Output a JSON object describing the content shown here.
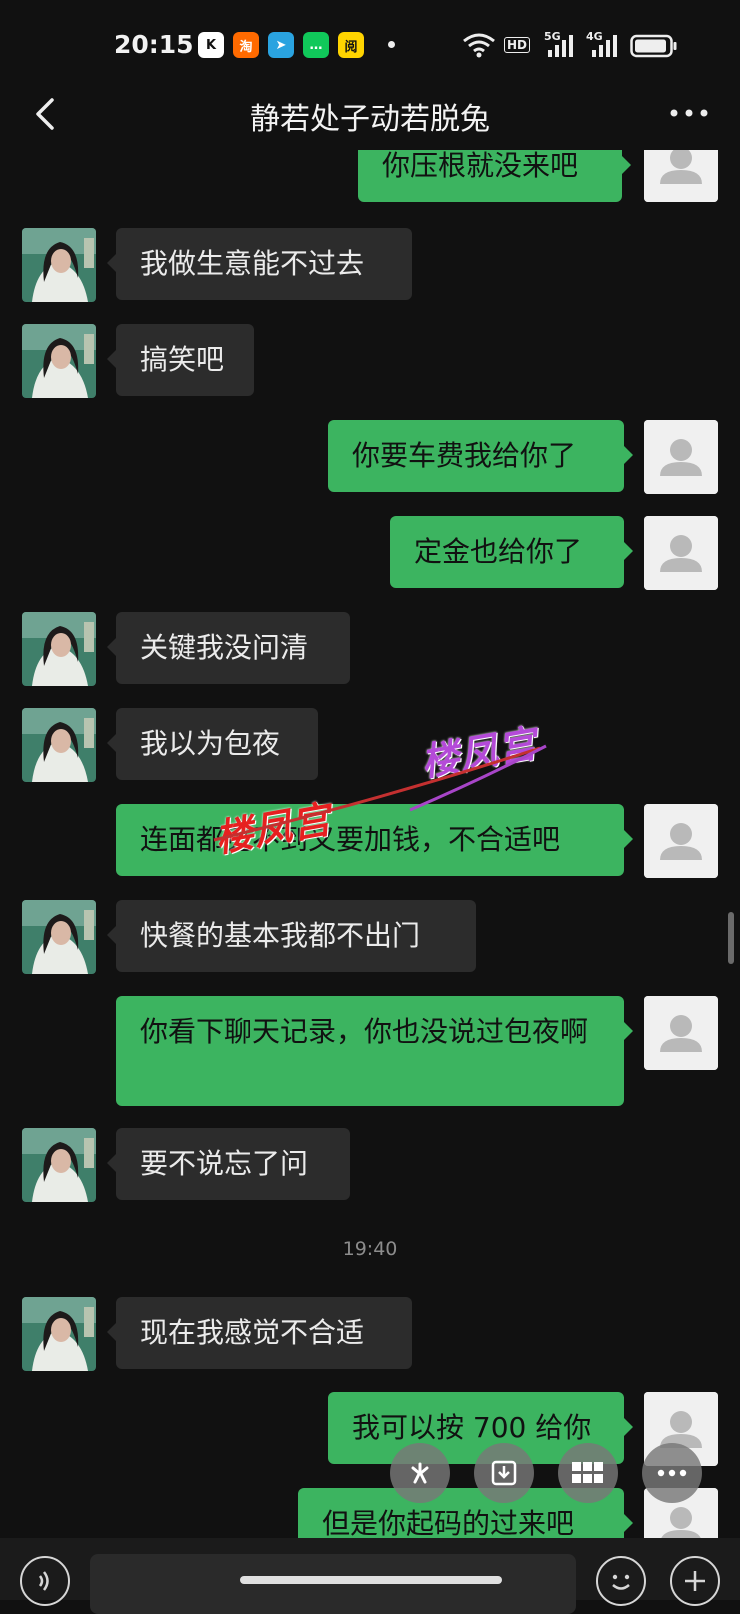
{
  "status_bar": {
    "time": "20:15",
    "app_icons": [
      {
        "name": "kuaishou-icon",
        "glyph": "K",
        "bg": "#ffffff",
        "fg": "#111111"
      },
      {
        "name": "taobao-icon",
        "glyph": "淘",
        "bg": "#ff6a00",
        "fg": "#ffffff"
      },
      {
        "name": "telegram-icon",
        "glyph": "➤",
        "bg": "#2aa3e0",
        "fg": "#ffffff"
      },
      {
        "name": "message-icon",
        "glyph": "…",
        "bg": "#10c85a",
        "fg": "#ffffff"
      },
      {
        "name": "reader-icon",
        "glyph": "阅",
        "bg": "#ffd400",
        "fg": "#111111"
      }
    ],
    "hd_label": "HD",
    "net1": "5G",
    "net2": "4G"
  },
  "header": {
    "title": "静若处子动若脱兔"
  },
  "messages": [
    {
      "dir": "out",
      "text": "你压根就没来吧"
    },
    {
      "dir": "in",
      "text": "我做生意能不过去"
    },
    {
      "dir": "in",
      "text": "搞笑吧"
    },
    {
      "dir": "out",
      "text": "你要车费我给你了"
    },
    {
      "dir": "out",
      "text": "定金也给你了"
    },
    {
      "dir": "in",
      "text": "关键我没问清"
    },
    {
      "dir": "in",
      "text": "我以为包夜"
    },
    {
      "dir": "out",
      "text": "连面都见不到又要加钱，不合适吧"
    },
    {
      "dir": "in",
      "text": "快餐的基本我都不出门"
    },
    {
      "dir": "out",
      "text": "你看下聊天记录，你也没说过包夜啊"
    },
    {
      "dir": "in",
      "text": "要不说忘了问"
    },
    {
      "dir": "in",
      "text": "现在我感觉不合适"
    },
    {
      "dir": "out",
      "text": "我可以按 700 给你"
    },
    {
      "dir": "out",
      "text": "但是你起码的过来吧"
    }
  ],
  "timestamp": "19:40",
  "watermarks": [
    "楼凤宫",
    "楼凤宫"
  ],
  "colors": {
    "background": "#111111",
    "incoming_bubble": "#2c2c2c",
    "outgoing_bubble": "#3cb460"
  },
  "floating_buttons": [
    "lens-icon",
    "download-icon",
    "grid-icon",
    "more-horizontal-icon"
  ]
}
